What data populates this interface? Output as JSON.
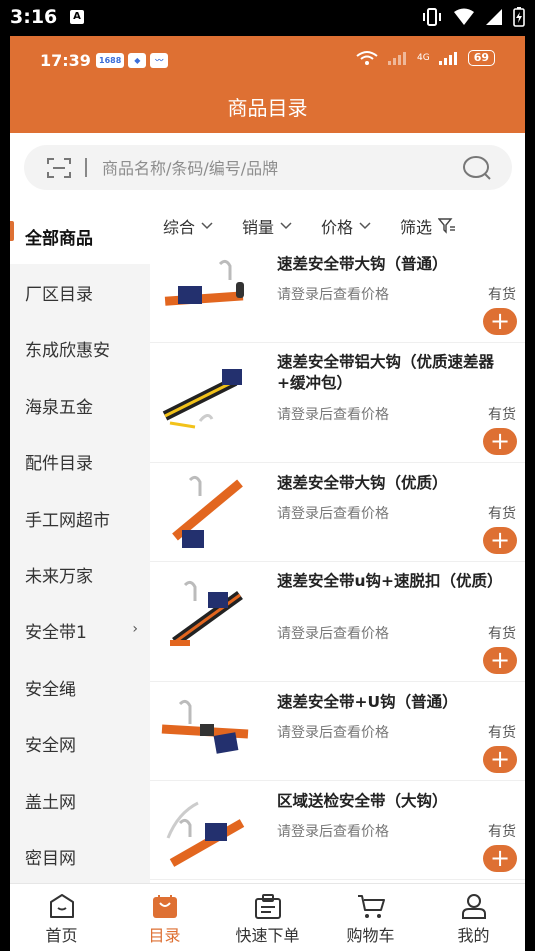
{
  "system": {
    "time": "3:16",
    "app_icon": "A"
  },
  "inner_status": {
    "time": "17:39",
    "badges": [
      "1688",
      "◆",
      "〰"
    ],
    "battery": "69",
    "net": "4G"
  },
  "header": {
    "title": "商品目录"
  },
  "search": {
    "placeholder": "商品名称/条码/编号/品牌"
  },
  "sidebar": {
    "items": [
      {
        "label": "全部商品",
        "active": true
      },
      {
        "label": "厂区目录"
      },
      {
        "label": "东成欣惠安"
      },
      {
        "label": "海泉五金"
      },
      {
        "label": "配件目录"
      },
      {
        "label": "手工网超市"
      },
      {
        "label": "未来万家"
      },
      {
        "label": "安全带1",
        "arrow": "›"
      },
      {
        "label": "安全绳"
      },
      {
        "label": "安全网"
      },
      {
        "label": "盖土网"
      },
      {
        "label": "密目网"
      }
    ]
  },
  "filters": [
    {
      "label": "综合"
    },
    {
      "label": "销量"
    },
    {
      "label": "价格"
    },
    {
      "label": "筛选"
    }
  ],
  "products": [
    {
      "name": "速差安全带大钩（普通）",
      "price_text": "请登录后查看价格",
      "stock": "有货",
      "add": "+"
    },
    {
      "name": "速差安全带铝大钩（优质速差器+缓冲包）",
      "price_text": "请登录后查看价格",
      "stock": "有货",
      "add": "+"
    },
    {
      "name": "速差安全带大钩（优质）",
      "price_text": "请登录后查看价格",
      "stock": "有货",
      "add": "+"
    },
    {
      "name": "速差安全带u钩+速脱扣（优质）",
      "price_text": "请登录后查看价格",
      "stock": "有货",
      "add": "+"
    },
    {
      "name": "速差安全带+U钩（普通）",
      "price_text": "请登录后查看价格",
      "stock": "有货",
      "add": "+"
    },
    {
      "name": "区域送检安全带（大钩）",
      "price_text": "请登录后查看价格",
      "stock": "有货",
      "add": "+"
    }
  ],
  "bottom_nav": [
    {
      "label": "首页",
      "icon": "home-icon"
    },
    {
      "label": "目录",
      "icon": "catalog-icon",
      "active": true
    },
    {
      "label": "快速下单",
      "icon": "quick-order-icon"
    },
    {
      "label": "购物车",
      "icon": "cart-icon"
    },
    {
      "label": "我的",
      "icon": "profile-icon"
    }
  ],
  "colors": {
    "accent": "#DE7033",
    "sidebar_bg": "#F4F4F4",
    "search_bg": "#F3F3F3"
  }
}
